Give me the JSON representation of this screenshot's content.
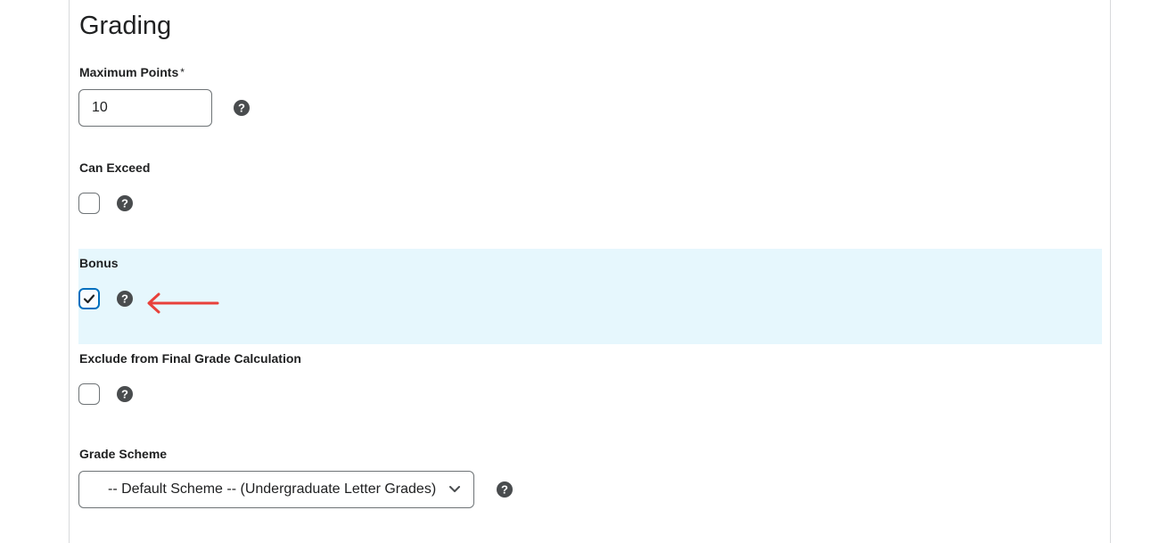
{
  "section": {
    "title": "Grading"
  },
  "max_points": {
    "label": "Maximum Points",
    "required_marker": "*",
    "value": "10"
  },
  "can_exceed": {
    "label": "Can Exceed",
    "checked": false
  },
  "bonus": {
    "label": "Bonus",
    "checked": true
  },
  "exclude": {
    "label": "Exclude from Final Grade Calculation",
    "checked": false
  },
  "grade_scheme": {
    "label": "Grade Scheme",
    "selected": "-- Default Scheme -- (Undergraduate Letter Grades)"
  },
  "colors": {
    "highlight": "#e6f7fd",
    "checkbox_checked_border": "#006fbf",
    "annotation_arrow": "#e8413b"
  },
  "icons": {
    "help": "question-circle-icon",
    "check": "checkmark-icon",
    "dropdown": "chevron-down-icon",
    "annotation": "arrow-left-icon"
  }
}
